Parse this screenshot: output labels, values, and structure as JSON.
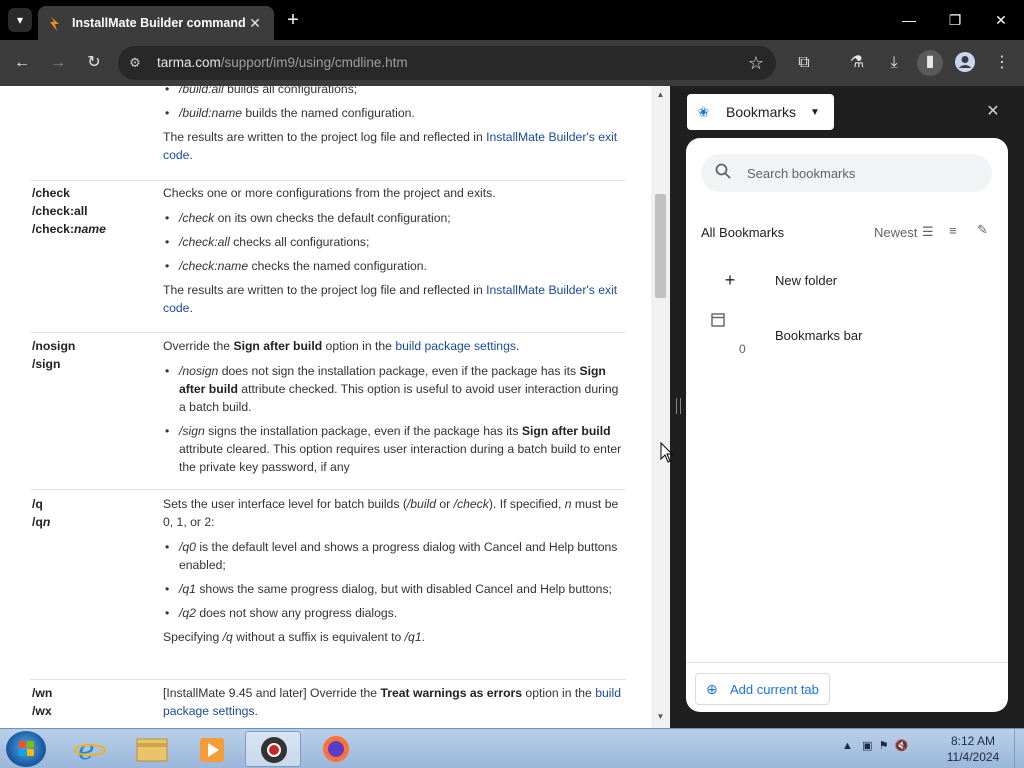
{
  "browser": {
    "tab_title": "InstallMate Builder command l",
    "url_host": "tarma.com",
    "url_path": "/support/im9/using/cmdline.htm"
  },
  "page": {
    "top_fragment": {
      "item1_code": "/build:all",
      "item1_text": " builds all configurations;",
      "item2_code": "/build:name",
      "item2_text": " builds the named configuration.",
      "results_pre": "The results are written to the project log file and reflected in ",
      "results_link": "InstallMate Builder's exit code",
      "results_post": "."
    },
    "rows": [
      {
        "opts": [
          "/check",
          "/check:all",
          "/check:name"
        ],
        "intro": "Checks one or more configurations from the project and exits.",
        "items": [
          {
            "code": "/check",
            "text": " on its own checks the default configuration;"
          },
          {
            "code": "/check:all",
            "text": " checks all configurations;"
          },
          {
            "code": "/check:name",
            "text": " checks the named configuration."
          }
        ],
        "results_pre": "The results are written to the project log file and reflected in ",
        "results_link": "InstallMate Builder's exit code",
        "results_post": "."
      },
      {
        "opts": [
          "/nosign",
          "/sign"
        ],
        "intro_pre": "Override the ",
        "intro_bold": "Sign after build",
        "intro_mid": " option in the ",
        "intro_link": "build package settings",
        "intro_post": ".",
        "item1_code": "/nosign",
        "item1_pre": " does not sign the installation package, even if the package has its ",
        "item1_bold": "Sign after build",
        "item1_post": " attribute checked. This option is useful to avoid user interaction during a batch build.",
        "item2_code": "/sign",
        "item2_pre": " signs the installation package, even if the package has its ",
        "item2_bold": "Sign after build",
        "item2_post": " attribute cleared. This option requires user interaction during a batch build to enter the private key password, if any"
      },
      {
        "opts": [
          "/q",
          "/qn"
        ],
        "intro_pre": "Sets the user interface level for batch builds (",
        "intro_c1": "/build",
        "intro_or": " or ",
        "intro_c2": "/check",
        "intro_mid": "). If specified, ",
        "intro_n": "n",
        "intro_post": " must be 0, 1, or 2:",
        "items": [
          {
            "code": "/q0",
            "text": " is the default level and shows a progress dialog with Cancel and Help buttons enabled;"
          },
          {
            "code": "/q1",
            "text": " shows the same progress dialog, but with disabled Cancel and Help buttons;"
          },
          {
            "code": "/q2",
            "text": " does not show any progress dialogs."
          }
        ],
        "outro_pre": "Specifying ",
        "outro_c1": "/q",
        "outro_mid": " without a suffix is equivalent to ",
        "outro_c2": "/q1",
        "outro_post": "."
      },
      {
        "opts": [
          "/wn",
          "/wx"
        ],
        "intro_pre": "[InstallMate 9.45 and later] Override the ",
        "intro_bold": "Treat warnings as errors",
        "intro_mid": " option in the ",
        "intro_link": "build package settings",
        "intro_post": "."
      }
    ]
  },
  "sidepanel": {
    "selector_label": "Bookmarks",
    "search_placeholder": "Search bookmarks",
    "all_label": "All Bookmarks",
    "sort_label": "Newest",
    "new_folder": "New folder",
    "bookmarks_bar": "Bookmarks bar",
    "bookmarks_bar_count": "0",
    "add_current_tab": "Add current tab"
  },
  "taskbar": {
    "time": "8:12 AM",
    "date": "11/4/2024"
  },
  "colors": {
    "link": "#1a4a9c",
    "accent": "#1a73e8",
    "toolbar": "#3c3c3c"
  }
}
